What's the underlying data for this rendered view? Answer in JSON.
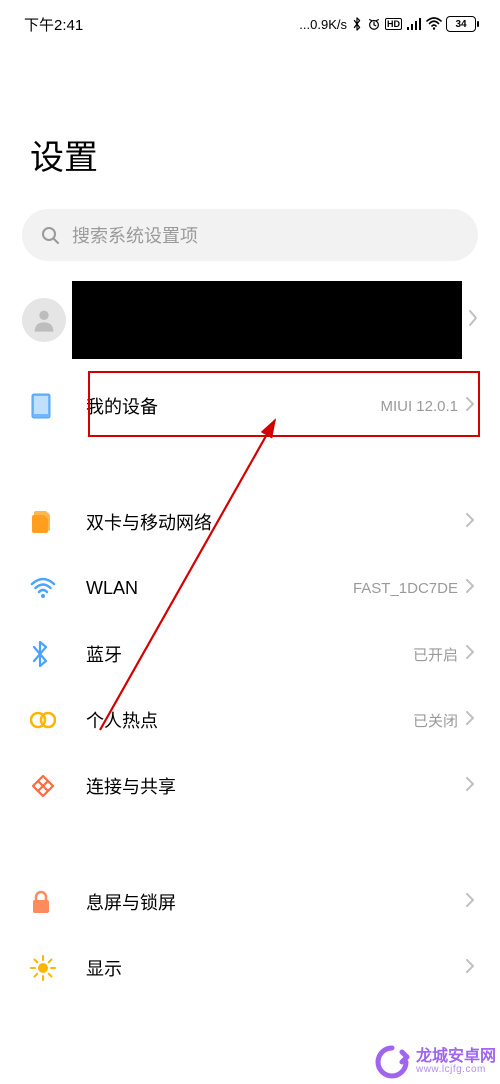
{
  "statusbar": {
    "time": "下午2:41",
    "net_speed": "...0.9K/s",
    "battery": "34"
  },
  "page": {
    "title": "设置"
  },
  "search": {
    "placeholder": "搜索系统设置项"
  },
  "rows": {
    "my_device": {
      "label": "我的设备",
      "value": "MIUI 12.0.1"
    },
    "sim": {
      "label": "双卡与移动网络",
      "value": ""
    },
    "wlan": {
      "label": "WLAN",
      "value": "FAST_1DC7DE"
    },
    "bluetooth": {
      "label": "蓝牙",
      "value": "已开启"
    },
    "hotspot": {
      "label": "个人热点",
      "value": "已关闭"
    },
    "connect": {
      "label": "连接与共享",
      "value": ""
    },
    "lock": {
      "label": "息屏与锁屏",
      "value": ""
    },
    "display": {
      "label": "显示",
      "value": ""
    }
  },
  "watermark": {
    "line1": "龙城安卓网",
    "line2": "www.lcjfg.com"
  }
}
